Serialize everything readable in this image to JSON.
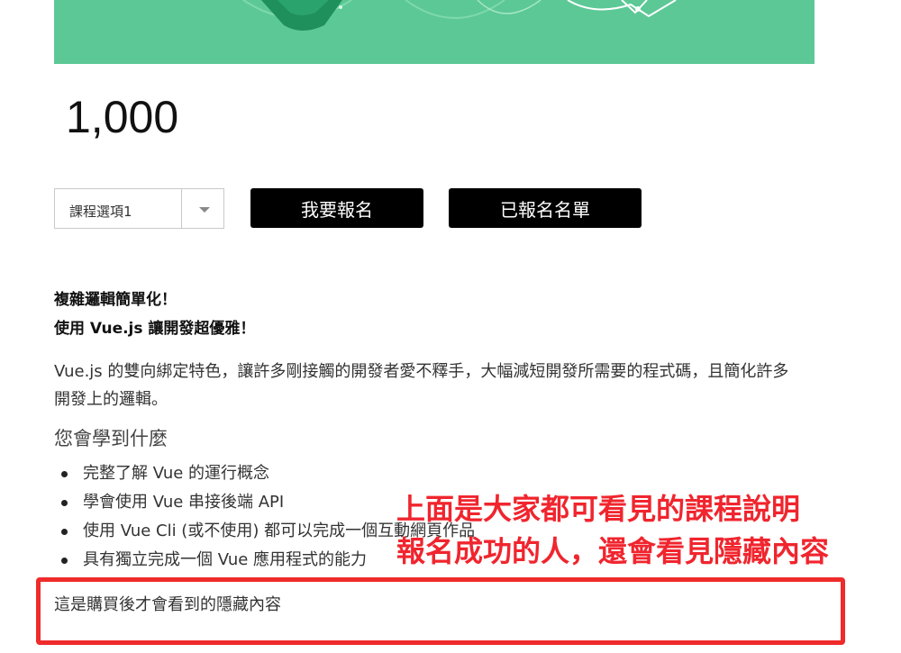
{
  "colors": {
    "banner": "#5cc896",
    "button_bg": "#000000",
    "annotation": "#f0252e",
    "highlight_border": "#ef2b2b"
  },
  "course": {
    "price": "1,000",
    "select": {
      "value": "課程選項1"
    },
    "buttons": {
      "enroll": "我要報名",
      "enrolled_list": "已報名名單"
    },
    "headline_1": "複雜邏輯簡單化！",
    "headline_2": "使用 Vue.js 讓開發超優雅！",
    "description": "Vue.js 的雙向綁定特色，讓許多剛接觸的開發者愛不釋手，大幅減短開發所需要的程式碼，且簡化許多開發上的邏輯。",
    "learn_title": "您會學到什麼",
    "learn_items": [
      "完整了解 Vue 的運行概念",
      "學會使用 Vue 串接後端 API",
      "使用 Vue Cli (或不使用) 都可以完成一個互動網頁作品",
      "具有獨立完成一個 Vue 應用程式的能力"
    ],
    "hidden_content": "這是購買後才會看到的隱藏內容"
  },
  "annotations": {
    "line_1": "上面是大家都可看見的課程說明",
    "line_2": "報名成功的人，還會看見隱藏內容"
  }
}
